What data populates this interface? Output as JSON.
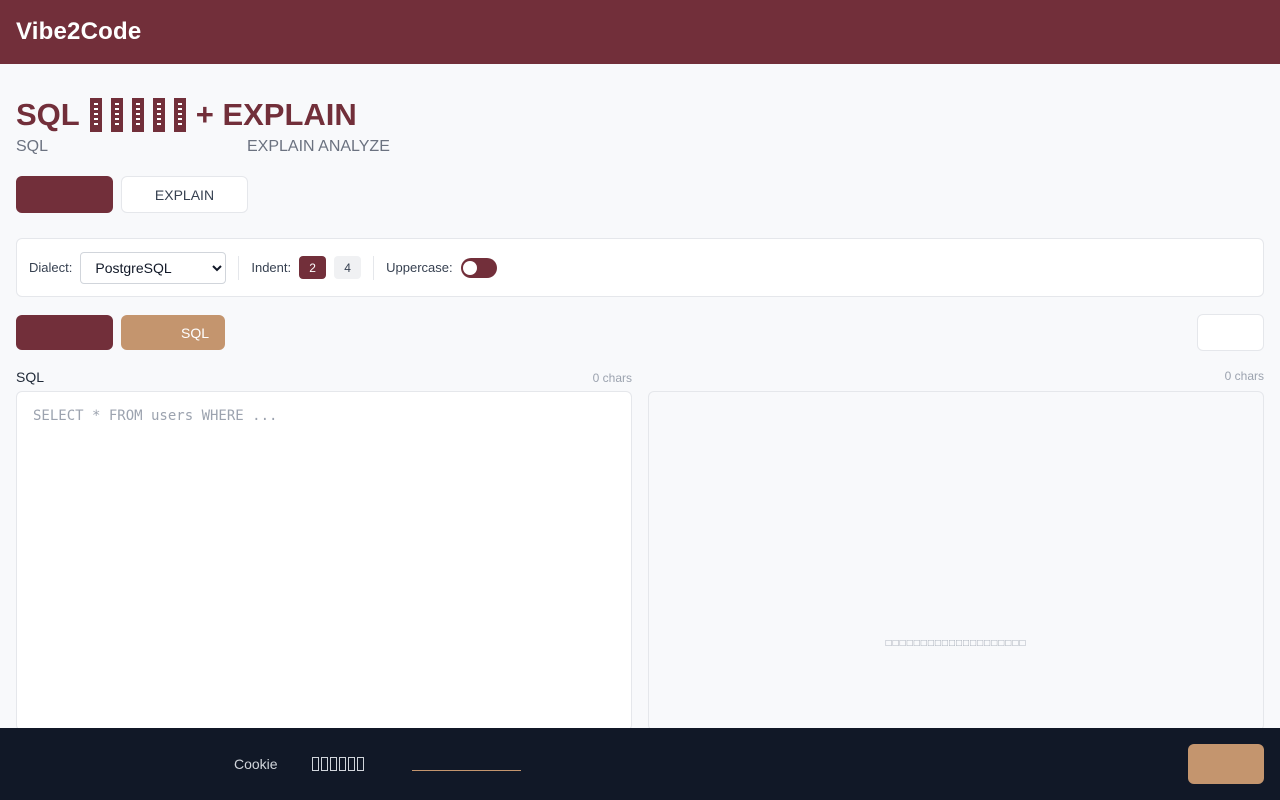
{
  "app": {
    "name": "Vibe2Code"
  },
  "page": {
    "title_prefix": "SQL",
    "title_suffix": "+ EXPLAIN",
    "subtitle_left": "SQL",
    "subtitle_right": "EXPLAIN ANALYZE"
  },
  "mode_tabs": {
    "explain_label": "EXPLAIN"
  },
  "options": {
    "dialect_label": "Dialect:",
    "dialect_value": "PostgreSQL",
    "indent_label": "Indent:",
    "indent_options": [
      "2",
      "4"
    ],
    "indent_selected": "2",
    "uppercase_label": "Uppercase:"
  },
  "actions": {
    "sql_label": "SQL"
  },
  "input_pane": {
    "title": "SQL",
    "char_count": "0 chars",
    "placeholder": "SELECT * FROM users WHERE ..."
  },
  "output_pane": {
    "char_count": "0 chars",
    "empty_hint": "□□□□□□□□□□□□□□□□□□□□"
  },
  "cookie_banner": {
    "text": "Cookie"
  },
  "colors": {
    "brand": "#722f3a",
    "accent": "#c4956e",
    "footer": "#111827"
  }
}
